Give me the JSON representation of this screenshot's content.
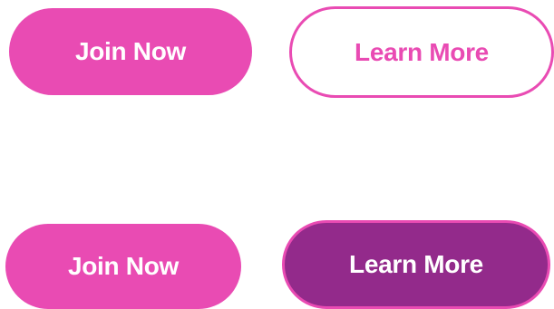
{
  "colors": {
    "primary_pink": "#e94bb3",
    "dark_purple": "#932a8b",
    "background": "#ffffff",
    "text_on_dark": "#ffffff"
  },
  "rows": [
    {
      "primary_button": {
        "label": "Join Now",
        "style": "solid-pink"
      },
      "secondary_button": {
        "label": "Learn More",
        "style": "outline-pink"
      }
    },
    {
      "primary_button": {
        "label": "Join Now",
        "style": "solid-pink"
      },
      "secondary_button": {
        "label": "Learn More",
        "style": "solid-purple-with-pink-border"
      }
    }
  ]
}
